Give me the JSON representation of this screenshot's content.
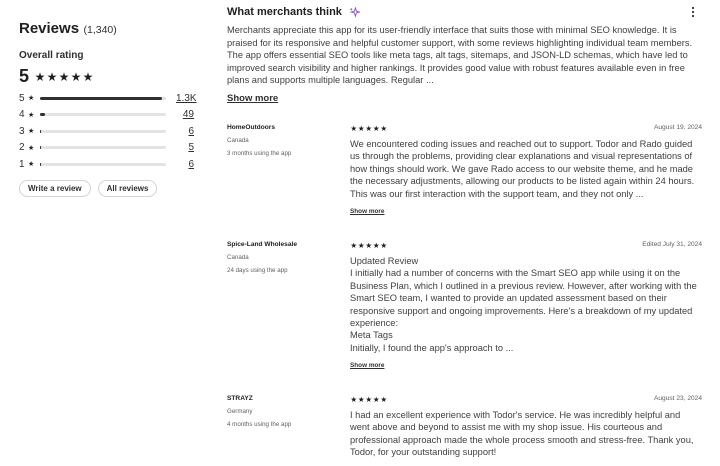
{
  "summary": {
    "title": "Reviews",
    "count": "(1,340)",
    "overall_label": "Overall rating",
    "overall_value": "5",
    "rows": [
      {
        "label": "5",
        "count": "1.3K",
        "fraction": 0.97
      },
      {
        "label": "4",
        "count": "49",
        "fraction": 0.04
      },
      {
        "label": "3",
        "count": "6",
        "fraction": 0.005
      },
      {
        "label": "2",
        "count": "5",
        "fraction": 0.004
      },
      {
        "label": "1",
        "count": "6",
        "fraction": 0.005
      }
    ],
    "write_review": "Write a review",
    "all_reviews": "All reviews"
  },
  "merchants": {
    "title": "What merchants think",
    "body": "Merchants appreciate this app for its user-friendly interface that suits those with minimal SEO knowledge. It is praised for its responsive and helpful customer support, with some reviews highlighting individual team members. The app offers essential SEO tools like meta tags, alt tags, sitemaps, and JSON-LD schemas, which have led to improved search visibility and higher rankings. It provides good value with robust features available even in free plans and supports multiple languages. Regular ...",
    "show_more": "Show more"
  },
  "reviews": [
    {
      "name": "HomeOutdoors",
      "country": "Canada",
      "usage": "3 months using the app",
      "date": "August 19, 2024",
      "body": "We encountered coding issues and reached out to support. Todor and Rado guided us through the problems, providing clear explanations and visual representations of how things should work. We gave Rado access to our website theme, and he made the necessary adjustments, allowing our products to be listed again within 24 hours. This was our first interaction with the support team, and they not only ...",
      "show_more": "Show more"
    },
    {
      "name": "Spice-Land Wholesale",
      "country": "Canada",
      "usage": "24 days using the app",
      "date": "Edited July 31, 2024",
      "body_lines": [
        "Updated Review",
        "I initially had a number of concerns with the Smart SEO app while using it on the Business Plan, which I outlined in a previous review. However, after working with the Smart SEO team, I wanted to provide an updated assessment based on their responsive support and ongoing improvements. Here's a breakdown of my updated experience:",
        "Meta Tags",
        "Initially, I found the app's approach to ..."
      ],
      "show_more": "Show more"
    },
    {
      "name": "STRAYZ",
      "country": "Germany",
      "usage": "4 months using the app",
      "date": "August 23, 2024",
      "body": "I had an excellent experience with Todor's service. He was incredibly helpful and went above and beyond to assist me with my shop issue. His courteous and professional approach made the whole process smooth and stress-free. Thank you, Todor, for your outstanding support!"
    }
  ],
  "colors": {
    "text": "#303030",
    "bar_fill": "#303030",
    "bar_track": "#e3e3e3",
    "sparkle": "#8a4bdb"
  },
  "icons": {
    "star": "star-icon",
    "sparkle": "sparkle-icon",
    "menu": "kebab-menu-icon"
  }
}
